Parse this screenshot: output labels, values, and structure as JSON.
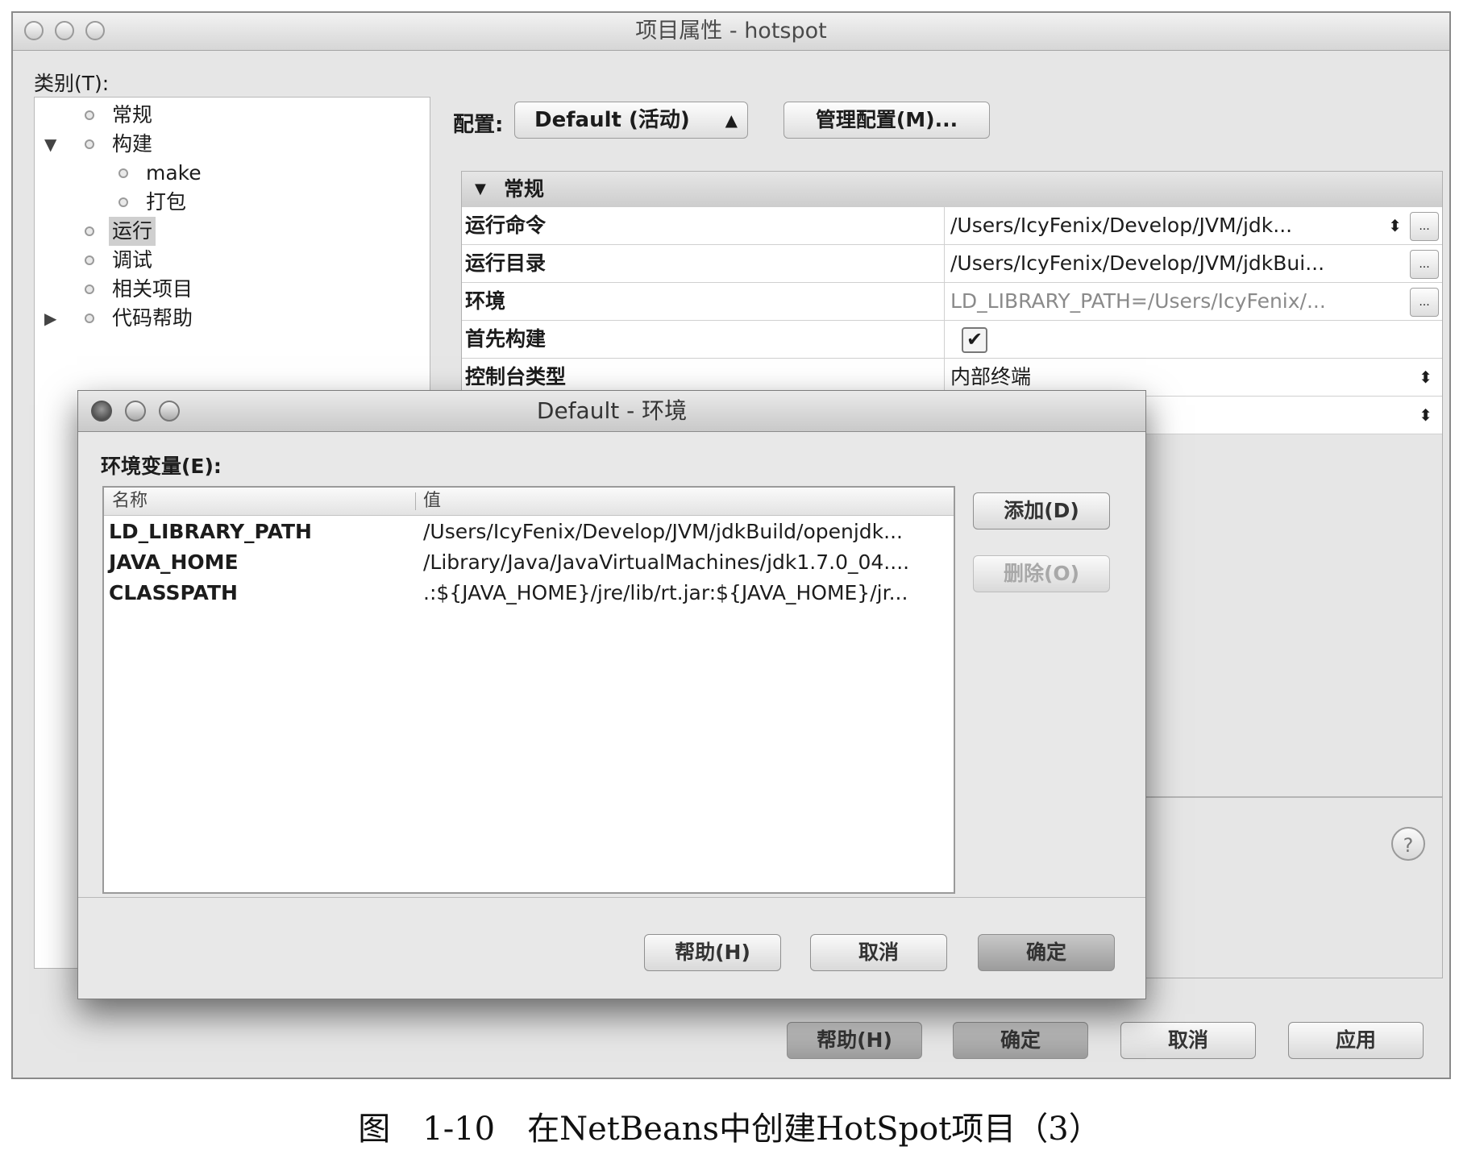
{
  "main_window": {
    "title": "项目属性 - hotspot",
    "category_label": "类别(T):",
    "tree": [
      {
        "label": "常规"
      },
      {
        "label": "构建"
      },
      {
        "label": "make"
      },
      {
        "label": "打包"
      },
      {
        "label": "运行"
      },
      {
        "label": "调试"
      },
      {
        "label": "相关项目"
      },
      {
        "label": "代码帮助"
      }
    ],
    "config_label": "配置:",
    "config_value": "Default (活动)",
    "manage_config": "管理配置(M)...",
    "section": "常规",
    "properties": [
      {
        "name": "运行命令",
        "value": "/Users/IcyFenix/Develop/JVM/jdk..."
      },
      {
        "name": "运行目录",
        "value": "/Users/IcyFenix/Develop/JVM/jdkBui..."
      },
      {
        "name": "环境",
        "value": "LD_LIBRARY_PATH=/Users/IcyFenix/..."
      },
      {
        "name": "首先构建",
        "value": ""
      },
      {
        "name": "控制台类型",
        "value": "内部终端"
      }
    ],
    "ellipsis": "...",
    "checkmark": "✔",
    "buttons": {
      "help": "帮助(H)",
      "ok": "确定",
      "cancel": "取消",
      "apply": "应用"
    }
  },
  "dialog": {
    "title": "Default - 环境",
    "env_label": "环境变量(E):",
    "columns": {
      "name": "名称",
      "value": "值"
    },
    "rows": [
      {
        "name": "LD_LIBRARY_PATH",
        "value": "/Users/IcyFenix/Develop/JVM/jdkBuild/openjdk..."
      },
      {
        "name": "JAVA_HOME",
        "value": "/Library/Java/JavaVirtualMachines/jdk1.7.0_04...."
      },
      {
        "name": "CLASSPATH",
        "value": ".:${JAVA_HOME}/jre/lib/rt.jar:${JAVA_HOME}/jr..."
      }
    ],
    "buttons": {
      "add": "添加(D)",
      "delete": "删除(O)",
      "help": "帮助(H)",
      "cancel": "取消",
      "ok": "确定"
    }
  },
  "caption": "图　1-10　在NetBeans中创建HotSpot项目（3）"
}
